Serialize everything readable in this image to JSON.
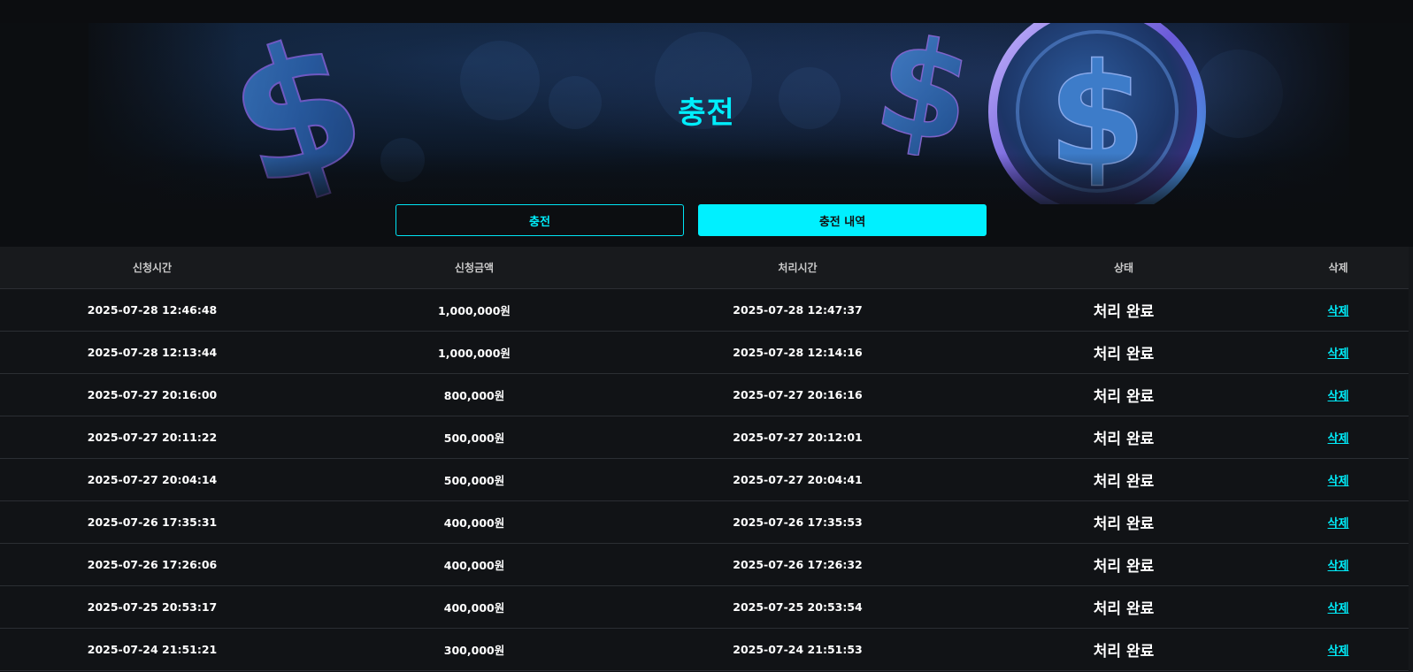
{
  "page": {
    "title": "충전"
  },
  "tabs": [
    {
      "label": "충전"
    },
    {
      "label": "충전 내역"
    }
  ],
  "table": {
    "headers": [
      "신청시간",
      "신청금액",
      "처리시간",
      "상태",
      "삭제"
    ],
    "rows": [
      {
        "request_time": "2025-07-28 12:46:48",
        "amount": "1,000,000원",
        "process_time": "2025-07-28 12:47:37",
        "status": "처리 완료",
        "delete": "삭제"
      },
      {
        "request_time": "2025-07-28 12:13:44",
        "amount": "1,000,000원",
        "process_time": "2025-07-28 12:14:16",
        "status": "처리 완료",
        "delete": "삭제"
      },
      {
        "request_time": "2025-07-27 20:16:00",
        "amount": "800,000원",
        "process_time": "2025-07-27 20:16:16",
        "status": "처리 완료",
        "delete": "삭제"
      },
      {
        "request_time": "2025-07-27 20:11:22",
        "amount": "500,000원",
        "process_time": "2025-07-27 20:12:01",
        "status": "처리 완료",
        "delete": "삭제"
      },
      {
        "request_time": "2025-07-27 20:04:14",
        "amount": "500,000원",
        "process_time": "2025-07-27 20:04:41",
        "status": "처리 완료",
        "delete": "삭제"
      },
      {
        "request_time": "2025-07-26 17:35:31",
        "amount": "400,000원",
        "process_time": "2025-07-26 17:35:53",
        "status": "처리 완료",
        "delete": "삭제"
      },
      {
        "request_time": "2025-07-26 17:26:06",
        "amount": "400,000원",
        "process_time": "2025-07-26 17:26:32",
        "status": "처리 완료",
        "delete": "삭제"
      },
      {
        "request_time": "2025-07-25 20:53:17",
        "amount": "400,000원",
        "process_time": "2025-07-25 20:53:54",
        "status": "처리 완료",
        "delete": "삭제"
      },
      {
        "request_time": "2025-07-24 21:51:21",
        "amount": "300,000원",
        "process_time": "2025-07-24 21:51:53",
        "status": "처리 완료",
        "delete": "삭제"
      }
    ]
  },
  "icons": [
    "dollar-sign-icon",
    "dollar-coin-icon"
  ],
  "colors": {
    "accent": "#00eefc",
    "background": "#0c0e11",
    "row_background": "#111316",
    "header_background": "#181a1d"
  }
}
